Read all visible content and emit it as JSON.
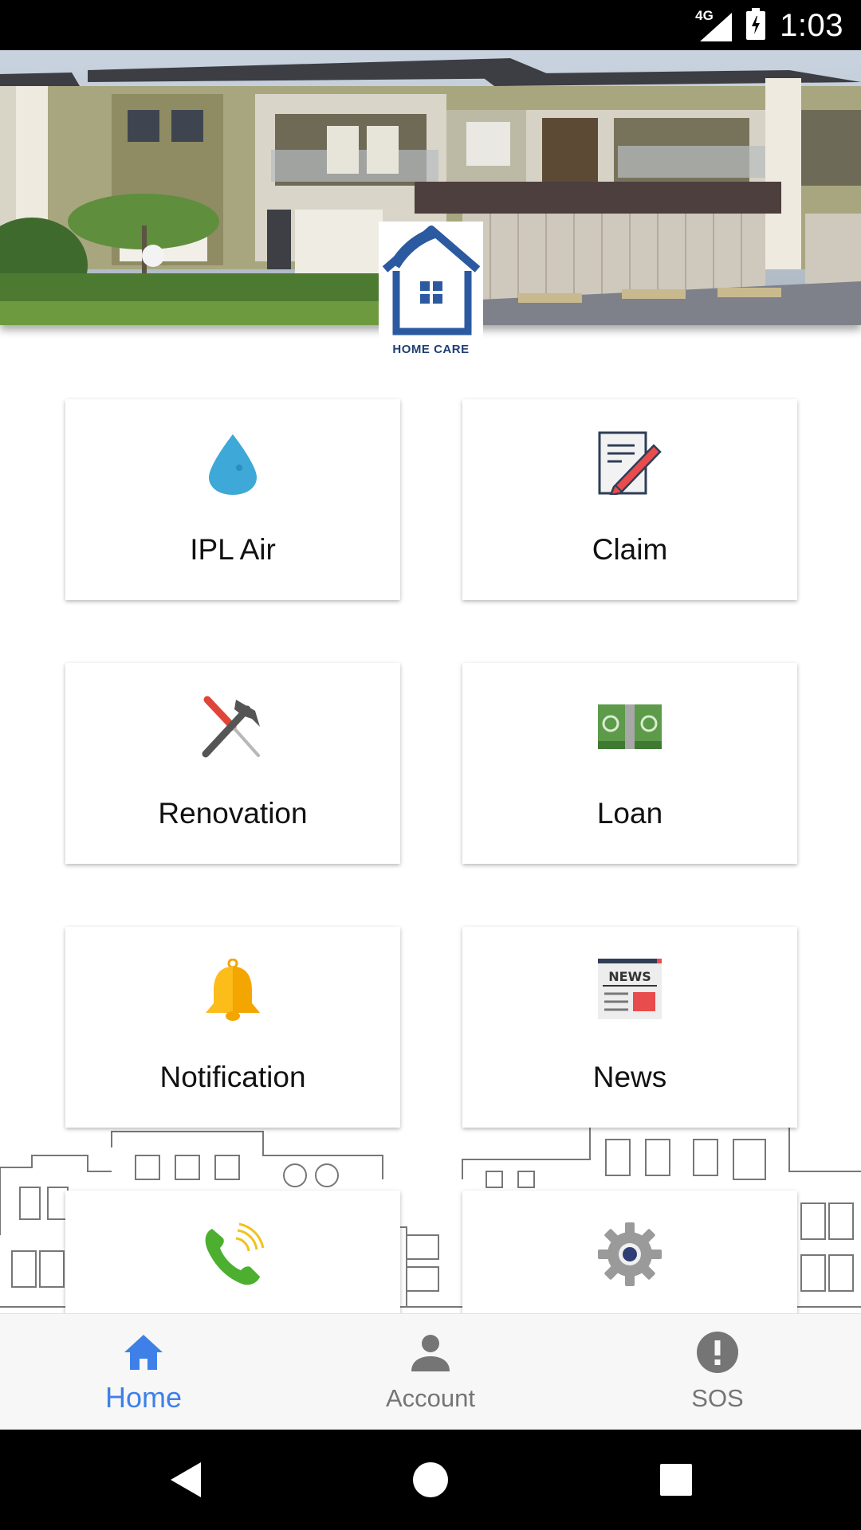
{
  "status_bar": {
    "network": "4G",
    "time": "1:03",
    "icons": [
      "signal-icon",
      "battery-icon"
    ]
  },
  "hero": {
    "logo_text": "HOME CARE",
    "colors": {
      "logo": "#2c5aa0"
    }
  },
  "menu": {
    "items": [
      {
        "label": "IPL Air",
        "icon": "water-drop-icon"
      },
      {
        "label": "Claim",
        "icon": "document-pen-icon"
      },
      {
        "label": "Renovation",
        "icon": "hammer-screwdriver-icon"
      },
      {
        "label": "Loan",
        "icon": "money-icon"
      },
      {
        "label": "Notification",
        "icon": "bell-icon"
      },
      {
        "label": "News",
        "icon": "newspaper-icon"
      },
      {
        "label": "",
        "icon": "phone-icon"
      },
      {
        "label": "",
        "icon": "gear-icon"
      }
    ]
  },
  "bottom_nav": {
    "items": [
      {
        "label": "Home",
        "icon": "home-icon",
        "active": true
      },
      {
        "label": "Account",
        "icon": "person-icon",
        "active": false
      },
      {
        "label": "SOS",
        "icon": "alert-icon",
        "active": false
      }
    ],
    "colors": {
      "active": "#3f80e8",
      "inactive": "#757575"
    }
  },
  "system_nav": {
    "buttons": [
      "back-icon",
      "home-circle-icon",
      "recents-icon"
    ]
  }
}
